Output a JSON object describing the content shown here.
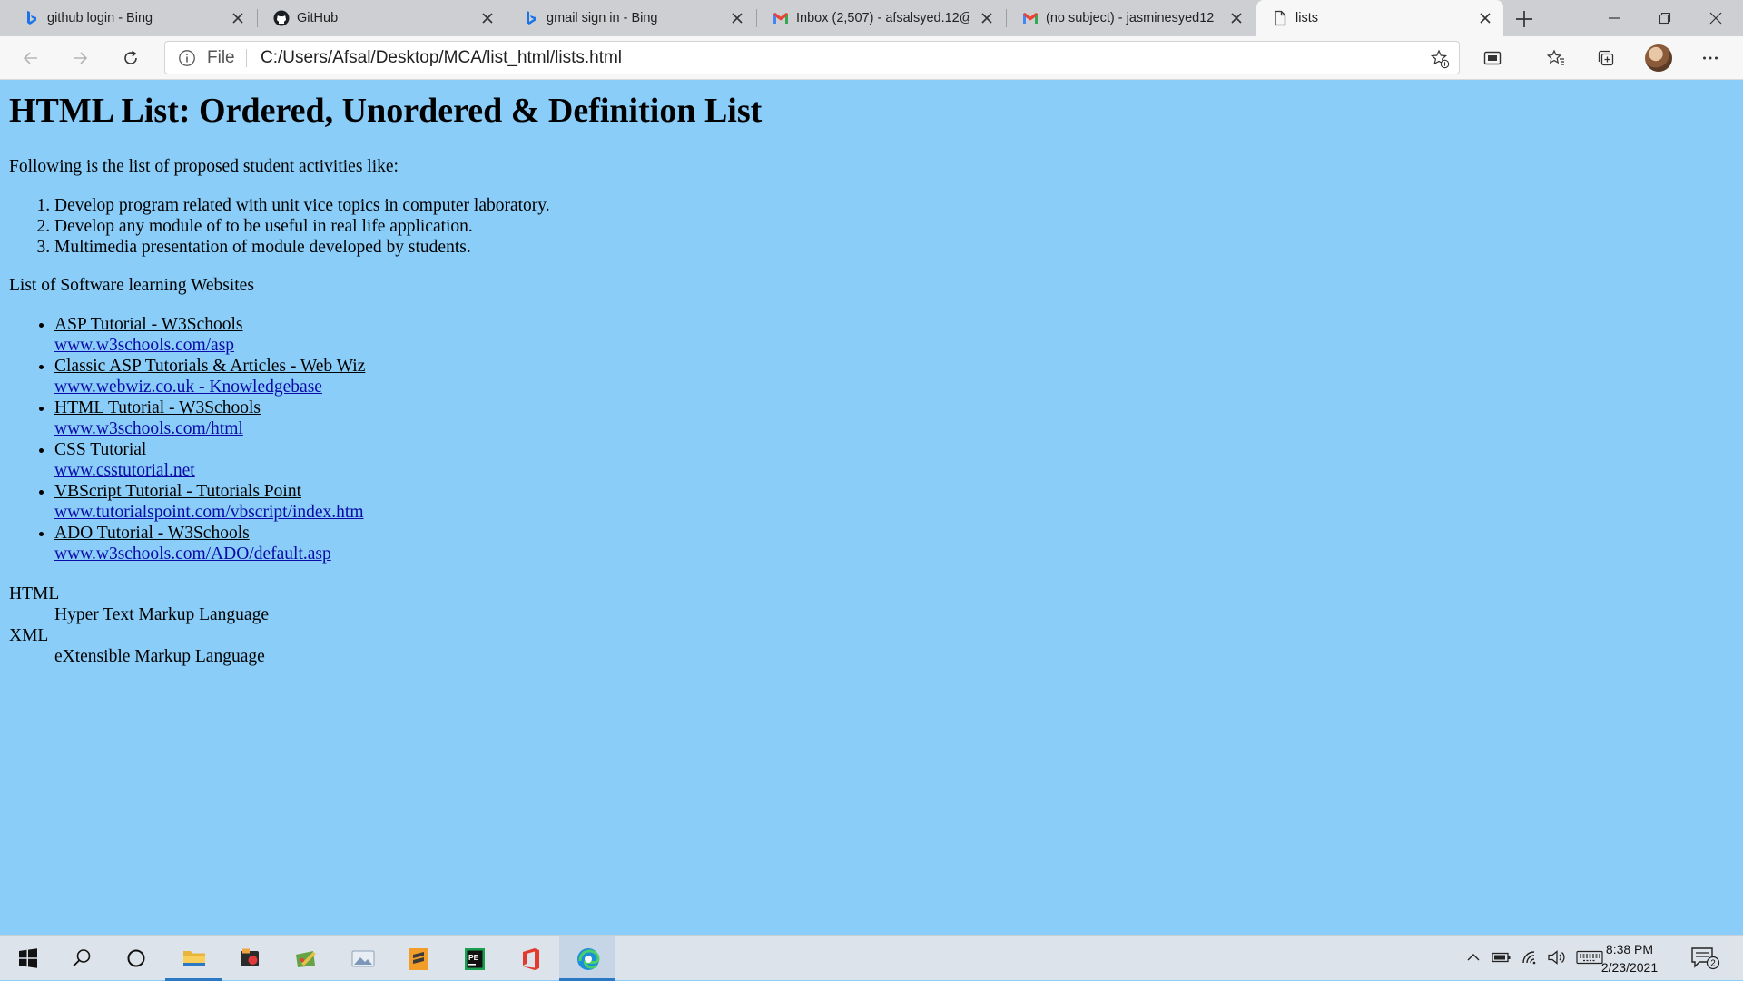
{
  "browser": {
    "tabs": [
      {
        "title": "github login - Bing",
        "favicon": "bing-icon",
        "active": false
      },
      {
        "title": "GitHub",
        "favicon": "github-icon",
        "active": false
      },
      {
        "title": "gmail sign in - Bing",
        "favicon": "bing-icon",
        "active": false
      },
      {
        "title": "Inbox (2,507) - afsalsyed.12@",
        "favicon": "gmail-icon",
        "active": false
      },
      {
        "title": "(no subject) - jasminesyed12",
        "favicon": "gmail-icon",
        "active": false
      },
      {
        "title": "lists",
        "favicon": "document-icon",
        "active": true
      }
    ],
    "address": {
      "scheme_label": "File",
      "url": "C:/Users/Afsal/Desktop/MCA/list_html/lists.html"
    }
  },
  "page": {
    "heading": "HTML List: Ordered, Unordered & Definition List",
    "intro": "Following is the list of proposed student activities like:",
    "activities": [
      "Develop program related with unit vice topics in computer laboratory.",
      "Develop any module of to be useful in real life application.",
      "Multimedia presentation of module developed by students."
    ],
    "websites_heading": "List of Software learning Websites",
    "websites": [
      {
        "title": "ASP Tutorial - W3Schools",
        "url": "www.w3schools.com/asp"
      },
      {
        "title": "Classic ASP Tutorials & Articles - Web Wiz",
        "url": "www.webwiz.co.uk - Knowledgebase"
      },
      {
        "title": "HTML Tutorial - W3Schools",
        "url": "www.w3schools.com/html"
      },
      {
        "title": "CSS Tutorial",
        "url": "www.csstutorial.net"
      },
      {
        "title": "VBScript Tutorial - Tutorials Point",
        "url": "www.tutorialspoint.com/vbscript/index.htm"
      },
      {
        "title": "ADO Tutorial - W3Schools",
        "url": "www.w3schools.com/ADO/default.asp"
      }
    ],
    "definitions": [
      {
        "term": "HTML",
        "desc": "Hyper Text Markup Language"
      },
      {
        "term": "XML",
        "desc": "eXtensible Markup Language"
      }
    ]
  },
  "taskbar": {
    "time": "8:38 PM",
    "date": "2/23/2021",
    "notification_count": "2"
  },
  "colors": {
    "page_background": "#89cdf8",
    "link_url": "#0a0aa8",
    "tab_strip": "#cdcfd2",
    "toolbar": "#f7f7f7"
  }
}
